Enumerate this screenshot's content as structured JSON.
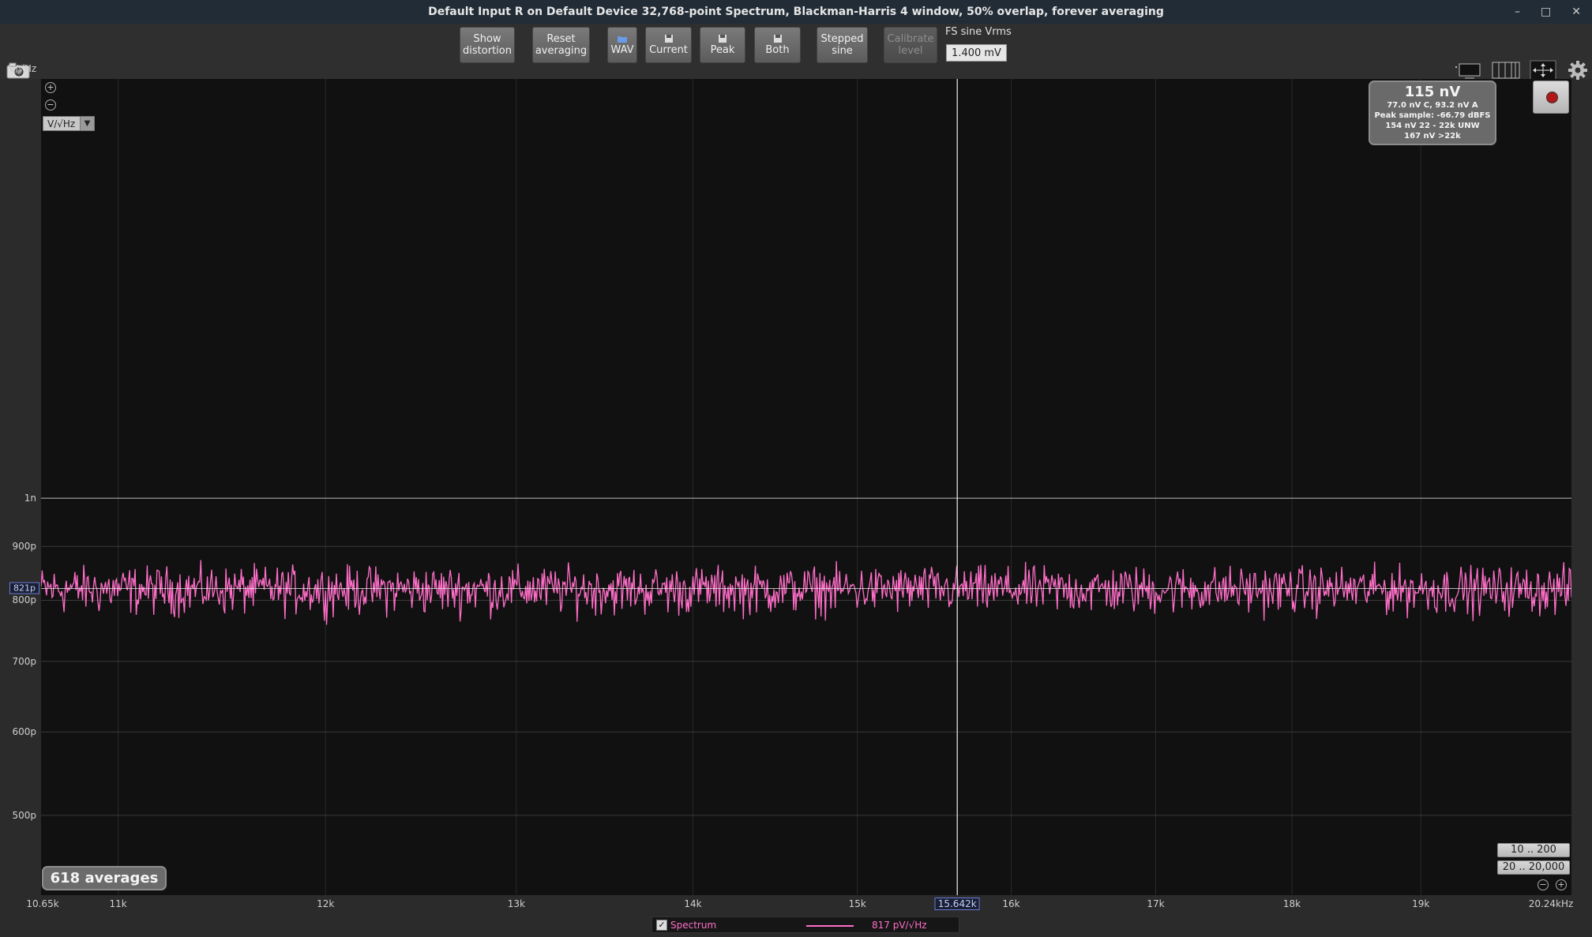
{
  "window": {
    "title": "Default Input R on Default Device 32,768-point Spectrum, Blackman-Harris 4 window, 50% overlap, forever averaging",
    "controls": [
      "–",
      "□",
      "✕"
    ]
  },
  "toolbar": {
    "show_distortion": [
      "Show",
      "distortion"
    ],
    "reset_averaging": [
      "Reset",
      "averaging"
    ],
    "wav": "WAV",
    "current": "Current",
    "peak": "Peak",
    "both": "Both",
    "stepped_sine": [
      "Stepped",
      "sine"
    ],
    "calibrate_level": [
      "Calibrate",
      "level"
    ],
    "fs_sine_label": "FS sine Vrms",
    "fs_sine_value": "1.400 mV"
  },
  "left_unit_label": "V/√Hz",
  "unit_selector": {
    "selected": "V/√Hz"
  },
  "summary": {
    "main": "115 nV",
    "lines": [
      "77.0 nV C, 93.2 nV A",
      "Peak sample: -66.79 dBFS",
      "154 nV 22 - 22k UNW",
      "167 nV >22k"
    ]
  },
  "averages_badge": "618 averages",
  "range_buttons": [
    "10 .. 200",
    "20 .. 20,000"
  ],
  "legend": {
    "checked": true,
    "series_name": "Spectrum",
    "value": "817 pV/√Hz",
    "color": "#ff6ec8"
  },
  "chart_data": {
    "type": "line",
    "x_unit": "Hz",
    "y_unit": "V/√Hz",
    "x_scale": "log",
    "y_scale": "log",
    "xlim": [
      10650,
      20240
    ],
    "ylim": [
      4.2e-10,
      2.5e-09
    ],
    "x_ticks": [
      {
        "value": 10650,
        "label": "10.65k"
      },
      {
        "value": 11000,
        "label": "11k"
      },
      {
        "value": 12000,
        "label": "12k"
      },
      {
        "value": 13000,
        "label": "13k"
      },
      {
        "value": 14000,
        "label": "14k"
      },
      {
        "value": 15000,
        "label": "15k"
      },
      {
        "value": 16000,
        "label": "16k"
      },
      {
        "value": 17000,
        "label": "17k"
      },
      {
        "value": 18000,
        "label": "18k"
      },
      {
        "value": 19000,
        "label": "19k"
      },
      {
        "value": 20240,
        "label": "20.24kHz"
      }
    ],
    "y_ticks": [
      {
        "value": 1e-09,
        "label": "1n"
      },
      {
        "value": 9e-10,
        "label": "900p"
      },
      {
        "value": 8e-10,
        "label": "800p"
      },
      {
        "value": 7e-10,
        "label": "700p"
      },
      {
        "value": 6e-10,
        "label": "600p"
      },
      {
        "value": 5e-10,
        "label": "500p"
      }
    ],
    "cursor": {
      "x": 15642,
      "x_label": "15.642k"
    },
    "level_marker": {
      "y": 8.21e-10,
      "label": "821p"
    },
    "series": [
      {
        "name": "Spectrum",
        "color": "#ff6ec8",
        "mean": 8.21e-10,
        "min": 7.55e-10,
        "max": 8.8e-10
      }
    ],
    "grid": true
  }
}
